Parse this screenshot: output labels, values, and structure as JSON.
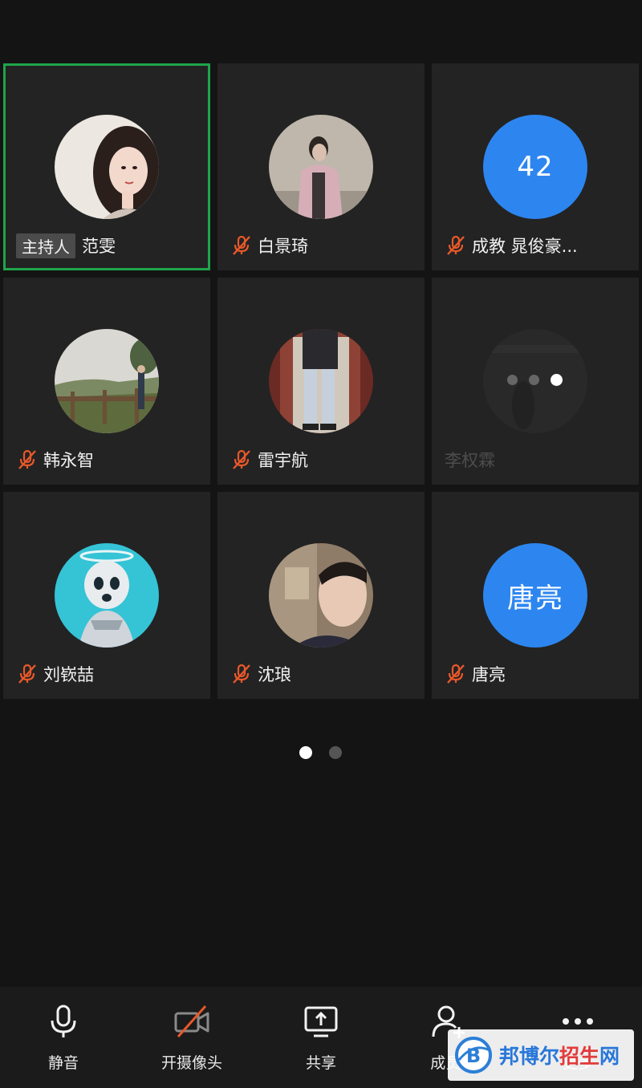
{
  "participants": [
    {
      "name": "范雯",
      "host_badge": "主持人",
      "muted": false,
      "avatar": "photo-anime-girl"
    },
    {
      "name": "白景琦",
      "muted": true,
      "avatar": "photo-young-man"
    },
    {
      "name": "成教 晁俊豪...",
      "muted": true,
      "avatar_text": "42"
    },
    {
      "name": "韩永智",
      "muted": true,
      "avatar": "photo-landscape-railing"
    },
    {
      "name": "雷宇航",
      "muted": true,
      "avatar": "photo-person-jeans"
    },
    {
      "name": "李权霖",
      "muted": false,
      "avatar": "loading"
    },
    {
      "name": "刘嵚喆",
      "muted": true,
      "avatar": "photo-cartoon-baby"
    },
    {
      "name": "沈琅",
      "muted": true,
      "avatar": "photo-selfie"
    },
    {
      "name": "唐亮",
      "muted": true,
      "avatar_text": "唐亮"
    }
  ],
  "pager": {
    "total": 2,
    "current": 1
  },
  "toolbar": {
    "mute_label": "静音",
    "camera_label": "开摄像头",
    "share_label": "共享",
    "members_label": "成员(",
    "more_label": "更多"
  },
  "watermark": {
    "part_a": "邦博尔",
    "part_b": "招生",
    "part_c": "网"
  },
  "colors": {
    "active_border": "#1fa54a",
    "avatar_blue": "#2d86ef",
    "mute_slash": "#e8582a"
  }
}
